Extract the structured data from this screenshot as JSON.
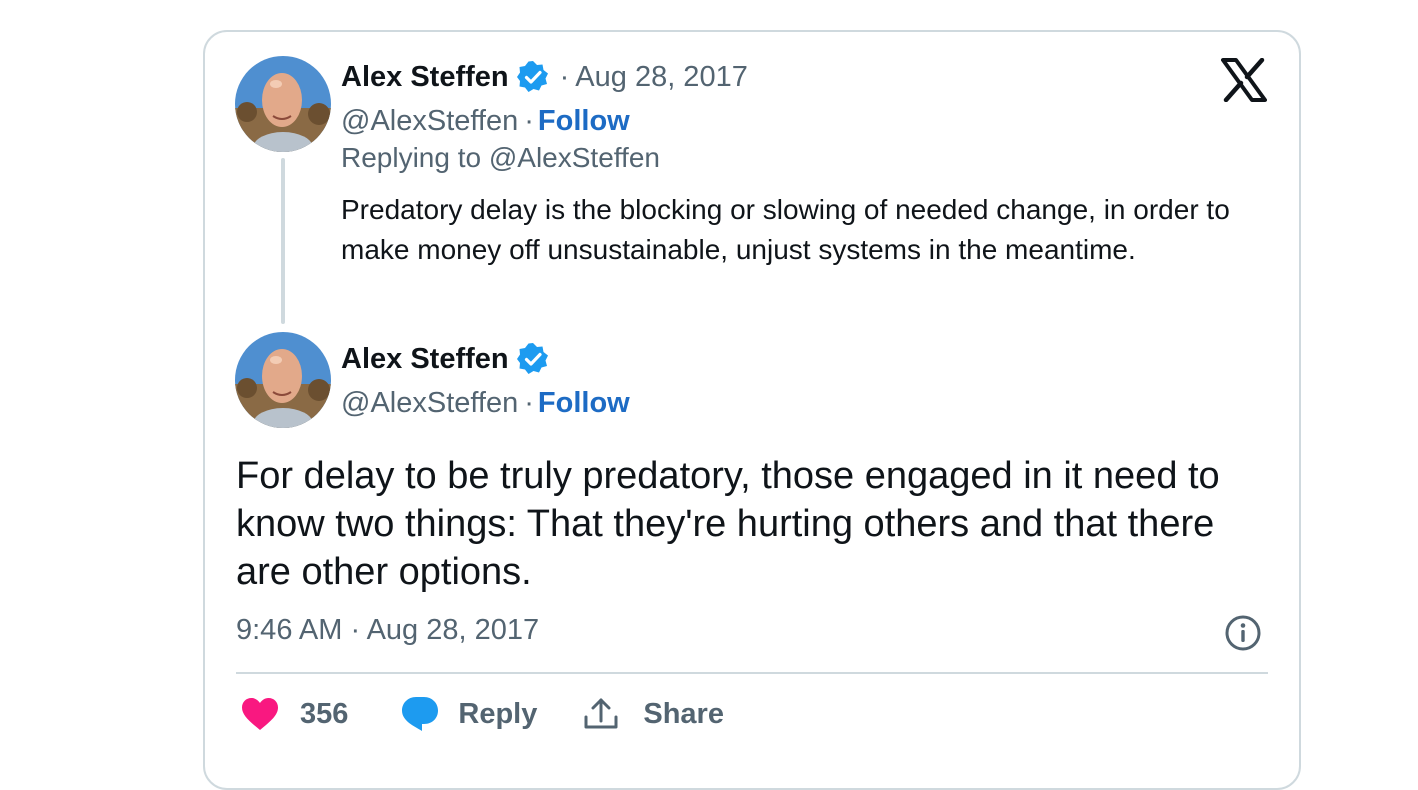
{
  "parent_tweet": {
    "author_name": "Alex Steffen",
    "date": "Aug 28, 2017",
    "handle": "@AlexSteffen",
    "follow_label": "Follow",
    "replying_to": "Replying to @AlexSteffen",
    "text": "Predatory delay is the blocking or slowing of needed change, in order to make money off unsustainable, unjust systems in the meantime."
  },
  "main_tweet": {
    "author_name": "Alex Steffen",
    "handle": "@AlexSteffen",
    "follow_label": "Follow",
    "text": "For delay to be truly predatory, those engaged in it need to know two  things: That they're hurting others and that there are other options.",
    "timestamp": "9:46 AM · Aug 28, 2017"
  },
  "actions": {
    "like_count": "356",
    "reply_label": "Reply",
    "share_label": "Share"
  },
  "separator": "·",
  "icons": {
    "verified": "verified-badge-icon",
    "brand": "x-logo-icon",
    "info": "info-icon",
    "like": "heart-icon",
    "reply": "speech-bubble-icon",
    "share": "share-upload-icon"
  },
  "colors": {
    "accent_link": "#1d6bc4",
    "verified_blue": "#1d9bf0",
    "like_pink": "#f91880",
    "secondary_text": "#536471",
    "border": "#cfd9de"
  }
}
